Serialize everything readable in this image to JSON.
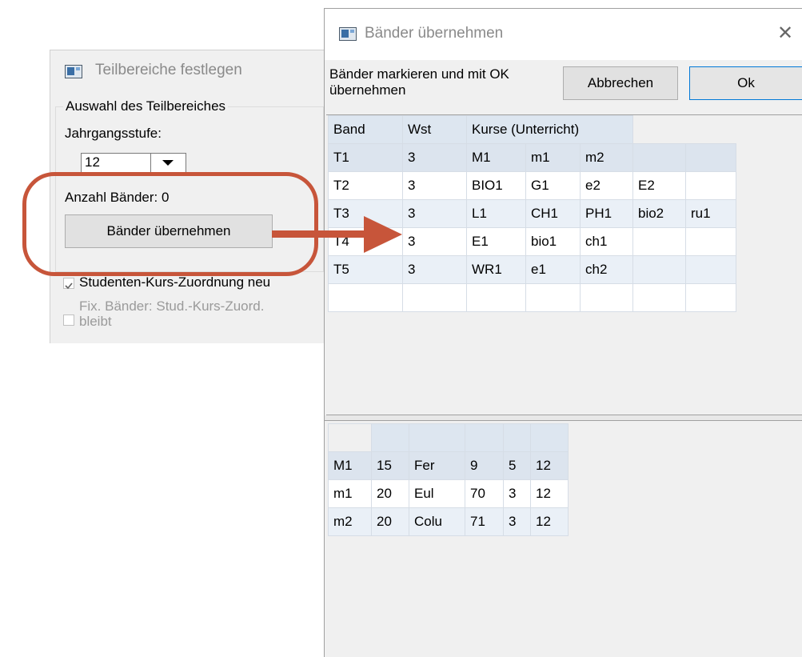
{
  "left_dialog": {
    "title": "Teilbereiche festlegen",
    "group_label": "Auswahl des Teilbereiches",
    "year_label": "Jahrgangsstufe:",
    "year_value": "12",
    "band_count": "Anzahl Bänder: 0",
    "button_label": "Bänder übernehmen",
    "checkbox1_label": "Studenten-Kurs-Zuordnung neu",
    "checkbox1_checked": true,
    "checkbox2_label_line1": "Fix. Bänder: Stud.-Kurs-Zuord.",
    "checkbox2_label_line2": "bleibt",
    "checkbox2_checked": false
  },
  "right_dialog": {
    "title": "Bänder übernehmen",
    "instruction_line1": "Bänder markieren und mit OK",
    "instruction_line2": "übernehmen",
    "cancel_label": "Abbrechen",
    "ok_label": "Ok",
    "close_glyph": "✕",
    "bands_table": {
      "headers": [
        "Band",
        "Wst",
        "Kurse (Unterricht)"
      ],
      "rows": [
        [
          "T1",
          "3",
          "M1",
          "m1",
          "m2",
          "",
          ""
        ],
        [
          "T2",
          "3",
          "BIO1",
          "G1",
          "e2",
          "E2",
          ""
        ],
        [
          "T3",
          "3",
          "L1",
          "CH1",
          "PH1",
          "bio2",
          "ru1"
        ],
        [
          "T4",
          "3",
          "E1",
          "bio1",
          "ch1",
          "",
          ""
        ],
        [
          "T5",
          "3",
          "WR1",
          "e1",
          "ch2",
          "",
          ""
        ],
        [
          "",
          "",
          "",
          "",
          "",
          "",
          ""
        ]
      ]
    },
    "detail_table": {
      "headers": [
        "",
        "",
        "",
        "",
        "",
        ""
      ],
      "rows": [
        [
          "M1",
          "15",
          "Fer",
          "9",
          "5",
          "12"
        ],
        [
          "m1",
          "20",
          "Eul",
          "70",
          "3",
          "12"
        ],
        [
          "m2",
          "20",
          "Colu",
          "71",
          "3",
          "12"
        ]
      ]
    }
  },
  "annotation_color": "#c7553a"
}
